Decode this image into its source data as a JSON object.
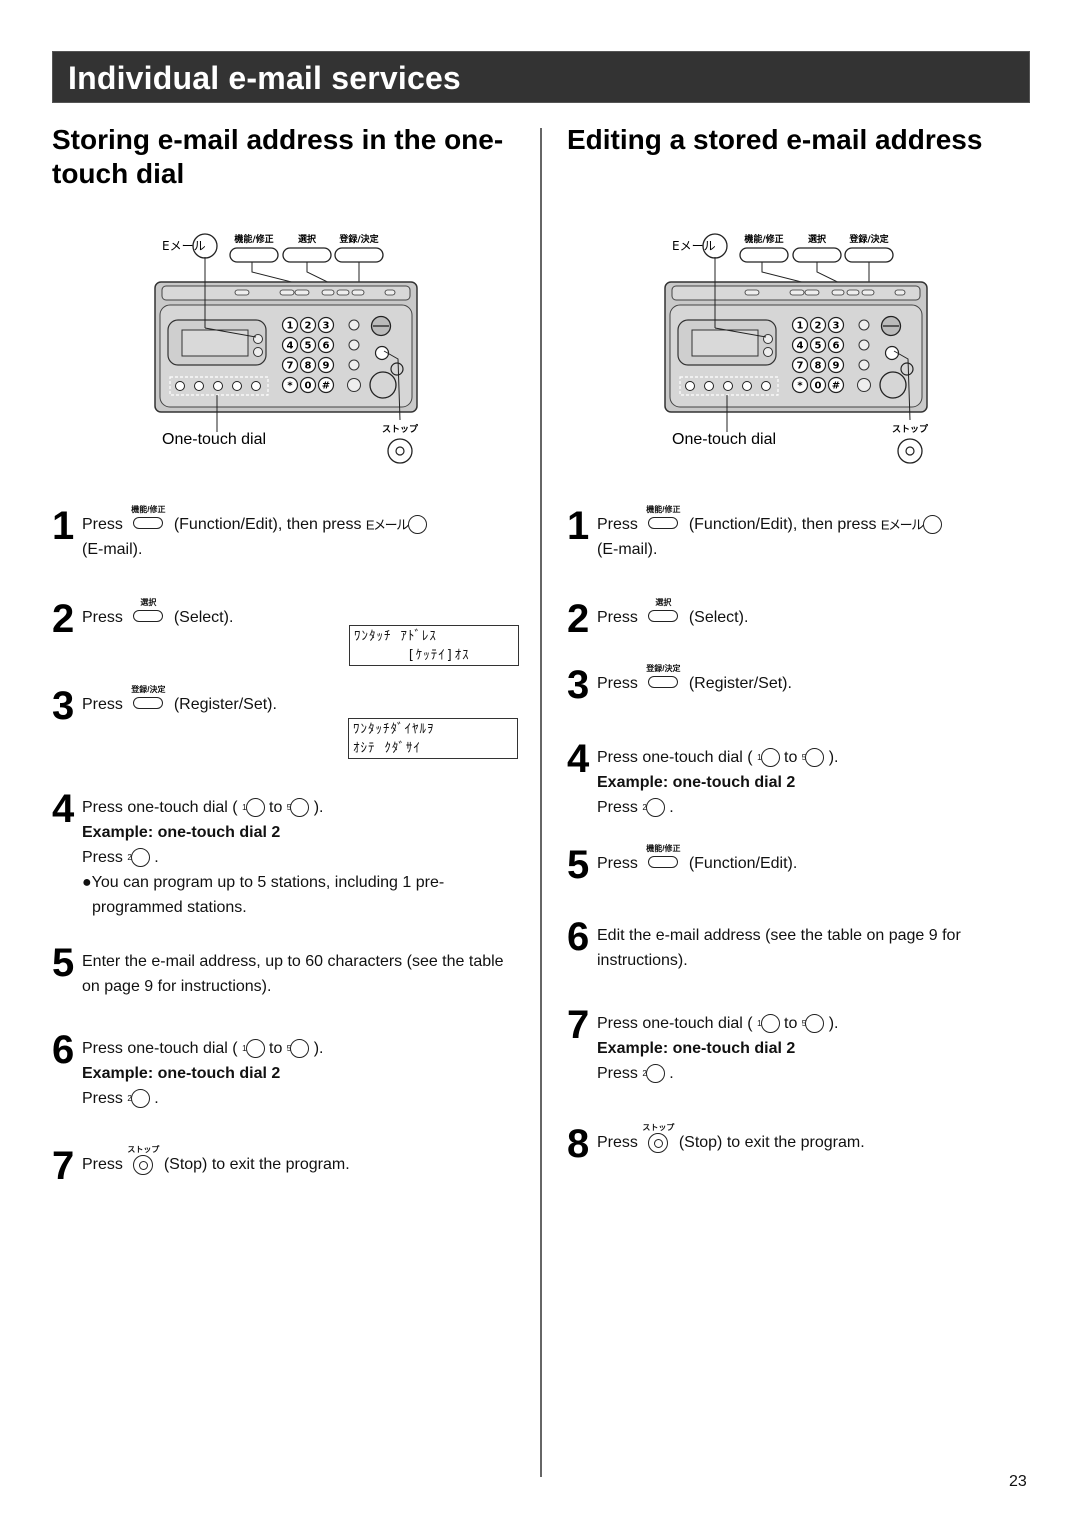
{
  "header": {
    "title": "Individual e-mail services"
  },
  "left": {
    "title": "Storing e-mail address in the one-touch dial",
    "diagram": {
      "email_label": "Eメール",
      "button_labels": [
        "機能/修正",
        "選択",
        "登録/決定"
      ],
      "keypad": [
        "1",
        "2",
        "3",
        "4",
        "5",
        "6",
        "7",
        "8",
        "9",
        "*",
        "0",
        "#"
      ],
      "one_touch_label": "One-touch dial",
      "stop_label": "ストップ"
    },
    "steps": [
      {
        "num": "1",
        "press": "Press",
        "btn_cap": "機能/修正",
        "after": "(Function/Edit), then press",
        "email_cap": "Eメール",
        "tail": "(E-mail)."
      },
      {
        "num": "2",
        "press": "Press",
        "btn_cap": "選択",
        "after": "(Select)."
      },
      {
        "num": "3",
        "press": "Press",
        "btn_cap": "登録/決定",
        "after": "(Register/Set)."
      },
      {
        "num": "4",
        "line1_a": "Press one-touch dial (",
        "sup1": "1",
        "to": "to",
        "sup5": "5",
        "line1_b": ").",
        "example": "Example: one-touch dial 2",
        "press": "Press",
        "sup2": "2",
        "dot": ".",
        "note": "●You can program up to 5 stations, including 1 pre-programmed stations."
      },
      {
        "num": "5",
        "text": "Enter the e-mail address, up to 60 characters (see the table on page 9 for instructions)."
      },
      {
        "num": "6",
        "line1_a": "Press one-touch dial (",
        "sup1": "1",
        "to": "to",
        "sup5": "5",
        "line1_b": ").",
        "example": "Example: one-touch dial 2",
        "press": "Press",
        "sup2": "2",
        "dot": "."
      },
      {
        "num": "7",
        "press": "Press",
        "stop_cap": "ストップ",
        "after": "(Stop) to exit the program."
      }
    ],
    "lcd": [
      "ﾜﾝﾀｯﾁ ｱﾄﾞﾚｽ\n      [ｹｯﾃｲ]ｵｽ",
      "ﾜﾝﾀｯﾁﾀﾞｲﾔﾙｦ\nｵｼﾃ ｸﾀﾞｻｲ"
    ]
  },
  "right": {
    "title": "Editing a stored e-mail address",
    "diagram": {
      "email_label": "Eメール",
      "button_labels": [
        "機能/修正",
        "選択",
        "登録/決定"
      ],
      "keypad": [
        "1",
        "2",
        "3",
        "4",
        "5",
        "6",
        "7",
        "8",
        "9",
        "*",
        "0",
        "#"
      ],
      "one_touch_label": "One-touch dial",
      "stop_label": "ストップ"
    },
    "steps": [
      {
        "num": "1",
        "press": "Press",
        "btn_cap": "機能/修正",
        "after": "(Function/Edit), then press",
        "email_cap": "Eメール",
        "tail": "(E-mail)."
      },
      {
        "num": "2",
        "press": "Press",
        "btn_cap": "選択",
        "after": "(Select)."
      },
      {
        "num": "3",
        "press": "Press",
        "btn_cap": "登録/決定",
        "after": "(Register/Set)."
      },
      {
        "num": "4",
        "line1_a": "Press one-touch dial (",
        "sup1": "1",
        "to": "to",
        "sup5": "5",
        "line1_b": ").",
        "example": "Example: one-touch dial 2",
        "press": "Press",
        "sup2": "2",
        "dot": "."
      },
      {
        "num": "5",
        "press": "Press",
        "btn_cap": "機能/修正",
        "after": "(Function/Edit)."
      },
      {
        "num": "6",
        "text": "Edit the e-mail address (see the table on page 9 for instructions)."
      },
      {
        "num": "7",
        "line1_a": "Press one-touch dial (",
        "sup1": "1",
        "to": "to",
        "sup5": "5",
        "line1_b": ").",
        "example": "Example: one-touch dial 2",
        "press": "Press",
        "sup2": "2",
        "dot": "."
      },
      {
        "num": "8",
        "press": "Press",
        "stop_cap": "ストップ",
        "after": "(Stop) to exit the program."
      }
    ]
  },
  "footer": {
    "page_number": "23"
  }
}
